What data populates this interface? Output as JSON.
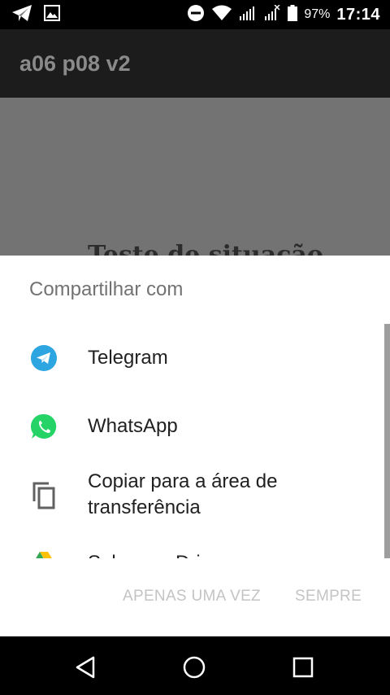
{
  "status_bar": {
    "battery_percent": "97%",
    "time": "17:14"
  },
  "app_bar": {
    "title": "a06 p08 v2"
  },
  "background": {
    "heading": "Teste de situação"
  },
  "share_sheet": {
    "title": "Compartilhar com",
    "items": [
      {
        "label": "Telegram",
        "icon": "telegram-icon"
      },
      {
        "label": "WhatsApp",
        "icon": "whatsapp-icon"
      },
      {
        "label": "Copiar para a área de transferência",
        "icon": "copy-icon"
      },
      {
        "label": "Salvar no Drive",
        "icon": "google-drive-icon"
      }
    ],
    "actions": {
      "once": "APENAS UMA VEZ",
      "always": "SEMPRE"
    }
  },
  "colors": {
    "telegram": "#2CA5E0",
    "whatsapp": "#25D366",
    "disabled_text": "#C4C4C4"
  }
}
